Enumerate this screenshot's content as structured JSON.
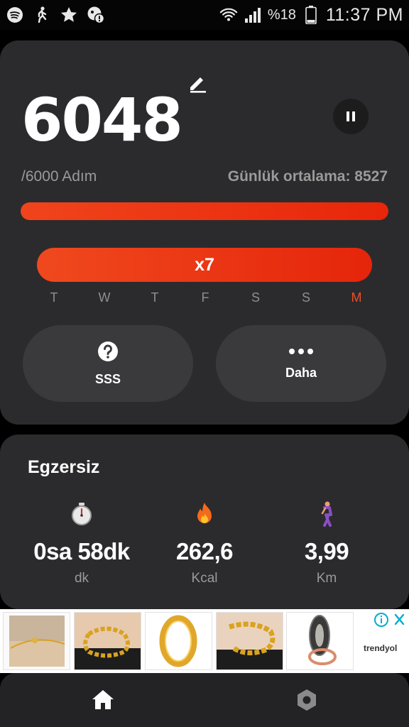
{
  "status_bar": {
    "battery_percent": "%18",
    "time": "11:37 PM",
    "left_icons": [
      "spotify-icon",
      "walking-icon",
      "star-icon",
      "shield-alert-icon"
    ],
    "right_icons": [
      "wifi-icon",
      "signal-icon",
      "battery-icon"
    ]
  },
  "steps_card": {
    "steps": "6048",
    "goal": "/6000 Adım",
    "daily_average": "Günlük ortalama: 8527",
    "progress": 1.0,
    "streak_label": "x7",
    "days": [
      {
        "label": "T",
        "active": false
      },
      {
        "label": "W",
        "active": false
      },
      {
        "label": "T",
        "active": false
      },
      {
        "label": "F",
        "active": false
      },
      {
        "label": "S",
        "active": false
      },
      {
        "label": "S",
        "active": false
      },
      {
        "label": "M",
        "active": true
      }
    ],
    "faq_label": "SSS",
    "more_label": "Daha"
  },
  "exercise": {
    "title": "Egzersiz",
    "stats": [
      {
        "icon": "stopwatch-icon",
        "value": "0sa 58dk",
        "unit": "dk"
      },
      {
        "icon": "fire-icon",
        "value": "262,6",
        "unit": "Kcal"
      },
      {
        "icon": "walking-person-icon",
        "value": "3,99",
        "unit": "Km"
      }
    ]
  },
  "ad": {
    "brand": "trendyol"
  },
  "colors": {
    "accent": "#ee4a22",
    "card": "#2b2b2d",
    "pill": "#3a3a3c",
    "background": "#000000"
  }
}
